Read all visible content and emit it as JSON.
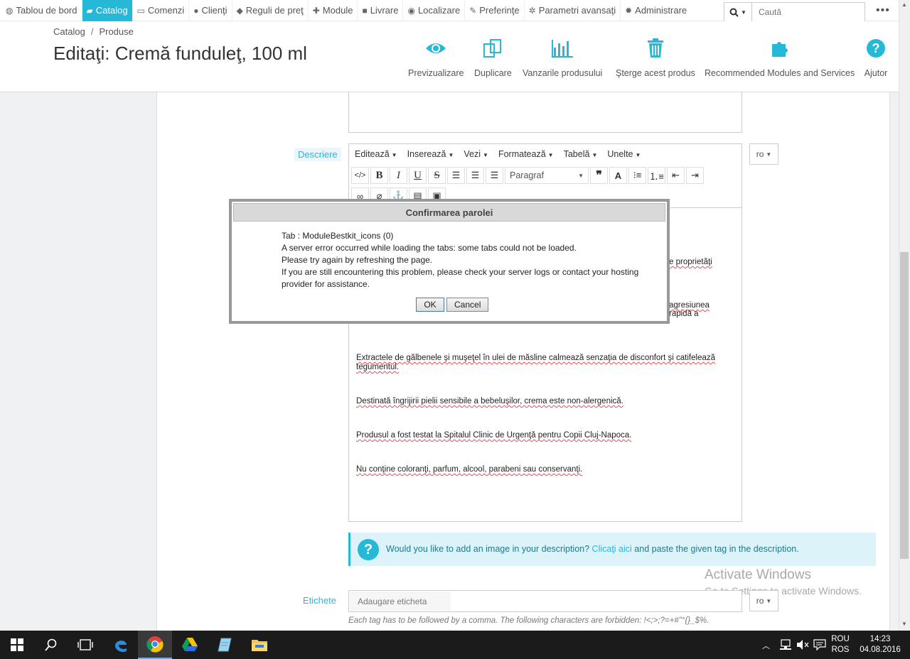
{
  "nav": {
    "items": [
      {
        "label": "Tablou de bord",
        "icon": "dashboard-icon",
        "active": false
      },
      {
        "label": "Catalog",
        "icon": "book-icon",
        "active": true
      },
      {
        "label": "Comenzi",
        "icon": "credit-card-icon",
        "active": false
      },
      {
        "label": "Clienţi",
        "icon": "users-icon",
        "active": false
      },
      {
        "label": "Reguli de preţ",
        "icon": "tags-icon",
        "active": false
      },
      {
        "label": "Module",
        "icon": "puzzle-icon",
        "active": false
      },
      {
        "label": "Livrare",
        "icon": "truck-icon",
        "active": false
      },
      {
        "label": "Localizare",
        "icon": "globe-icon",
        "active": false
      },
      {
        "label": "Preferinţe",
        "icon": "wrench-icon",
        "active": false
      },
      {
        "label": "Parametri avansaţi",
        "icon": "cogs-icon",
        "active": false
      },
      {
        "label": "Administrare",
        "icon": "cog-icon",
        "active": false
      }
    ],
    "search_placeholder": "Caută"
  },
  "header": {
    "breadcrumb": [
      "Catalog",
      "Produse"
    ],
    "title": "Editaţi: Cremă funduleţ, 100 ml",
    "toolbar": [
      {
        "label": "Previzualizare",
        "icon": "eye-icon"
      },
      {
        "label": "Duplicare",
        "icon": "copy-icon"
      },
      {
        "label": "Vanzarile produsului",
        "icon": "bar-chart-icon"
      },
      {
        "label": "Şterge acest produs",
        "icon": "trash-icon"
      },
      {
        "label": "Recommended Modules and Services",
        "icon": "puzzle-icon"
      },
      {
        "label": "Ajutor",
        "icon": "help-icon"
      }
    ]
  },
  "form": {
    "description_label": "Descriere",
    "editor_menu": [
      "Editează",
      "Inserează",
      "Vezi",
      "Formatează",
      "Tabelă",
      "Unelte"
    ],
    "format_select": "Paragraf",
    "lang": "ro",
    "paragraphs": {
      "p1_tail": "e proprietăţi",
      "p2_tail_a": "agresiunea",
      "p2_tail_b": "rapidă a",
      "p3": "Extractele de gălbenele şi muşeţel în ulei de măsline calmează senzaţia de disconfort şi catifelează tegumentul.",
      "p4": "Destinată îngrijirii pielii sensibile a bebeluşilor, crema este non-alergenică.",
      "p5": "Produsul a fost testat la Spitalul Clinic de Urgenţă pentru Copii Cluj-Napoca.",
      "p6": "Nu conţine coloranţi, parfum, alcool, parabeni sau conservanţi."
    },
    "info_text_before": "Would you like to add an image in your description?",
    "info_link": "Clicaţi aici",
    "info_text_after": "and paste the given tag in the description.",
    "tags_label": "Etichete",
    "tags_placeholder": "Adaugare eticheta",
    "tags_help": "Each tag has to be followed by a comma. The following characters are forbidden: !<;>;?=+#\"°{}_$%."
  },
  "dialog": {
    "title": "Confirmarea parolei",
    "lines": [
      "Tab : ModuleBestkit_icons (0)",
      "A server error occurred while loading the tabs: some tabs could not be loaded.",
      "Please try again by refreshing the page.",
      "If you are still encountering this problem, please check your server logs or contact your hosting provider for assistance."
    ],
    "ok": "OK",
    "cancel": "Cancel"
  },
  "watermark": {
    "line1": "Activate Windows",
    "line2": "Go to Settings to activate Windows."
  },
  "taskbar": {
    "lang_top": "ROU",
    "lang_bottom": "ROS",
    "time": "14:23",
    "date": "04.08.2016"
  }
}
